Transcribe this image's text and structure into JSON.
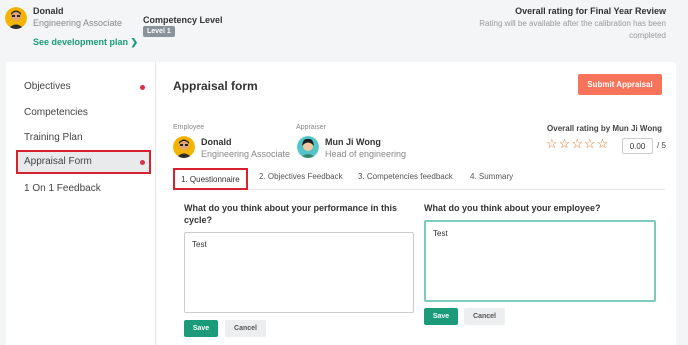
{
  "header": {
    "employee_name": "Donald",
    "employee_role": "Engineering Associate",
    "development_link": "See development plan ❯",
    "competency_label": "Competency Level",
    "competency_badge": "Level 1",
    "overall_title": "Overall rating for Final Year Review",
    "overall_note": "Rating will be available after the calibration has been completed"
  },
  "sidebar": {
    "items": [
      {
        "label": "Objectives",
        "has_dot": true
      },
      {
        "label": "Competencies",
        "has_dot": false
      },
      {
        "label": "Training Plan",
        "has_dot": false
      },
      {
        "label": "Appraisal Form",
        "has_dot": true,
        "active": true
      },
      {
        "label": "1 On 1 Feedback",
        "has_dot": false
      }
    ]
  },
  "form": {
    "title": "Appraisal form",
    "submit_label": "Submit Appraisal",
    "employee_label": "Employee",
    "employee_name": "Donald",
    "employee_role": "Engineering Associate",
    "appraiser_label": "Appraiser",
    "appraiser_name": "Mun Ji Wong",
    "appraiser_role": "Head of engineering",
    "rating_label": "Overall rating by Mun Ji Wong",
    "rating_value": "0.00",
    "rating_max": "/ 5",
    "stars_filled": 0,
    "stars_total": 5
  },
  "tabs": [
    {
      "label": "1. Questionnaire",
      "active": true
    },
    {
      "label": "2. Objectives Feedback",
      "active": false
    },
    {
      "label": "3. Competencies feedback",
      "active": false
    },
    {
      "label": "4. Summary",
      "active": false
    }
  ],
  "questions": [
    {
      "text": "What do you think about your performance in this cycle?",
      "answer": "Test",
      "save_label": "Save",
      "cancel_label": "Cancel"
    },
    {
      "text": "What do you think about your employee?",
      "answer": "Test",
      "save_label": "Save",
      "cancel_label": "Cancel"
    }
  ],
  "colors": {
    "accent_green": "#1b9b7a",
    "submit_orange": "#f7735a",
    "highlight_red": "#d9222f",
    "star_orange": "#e2732b"
  }
}
